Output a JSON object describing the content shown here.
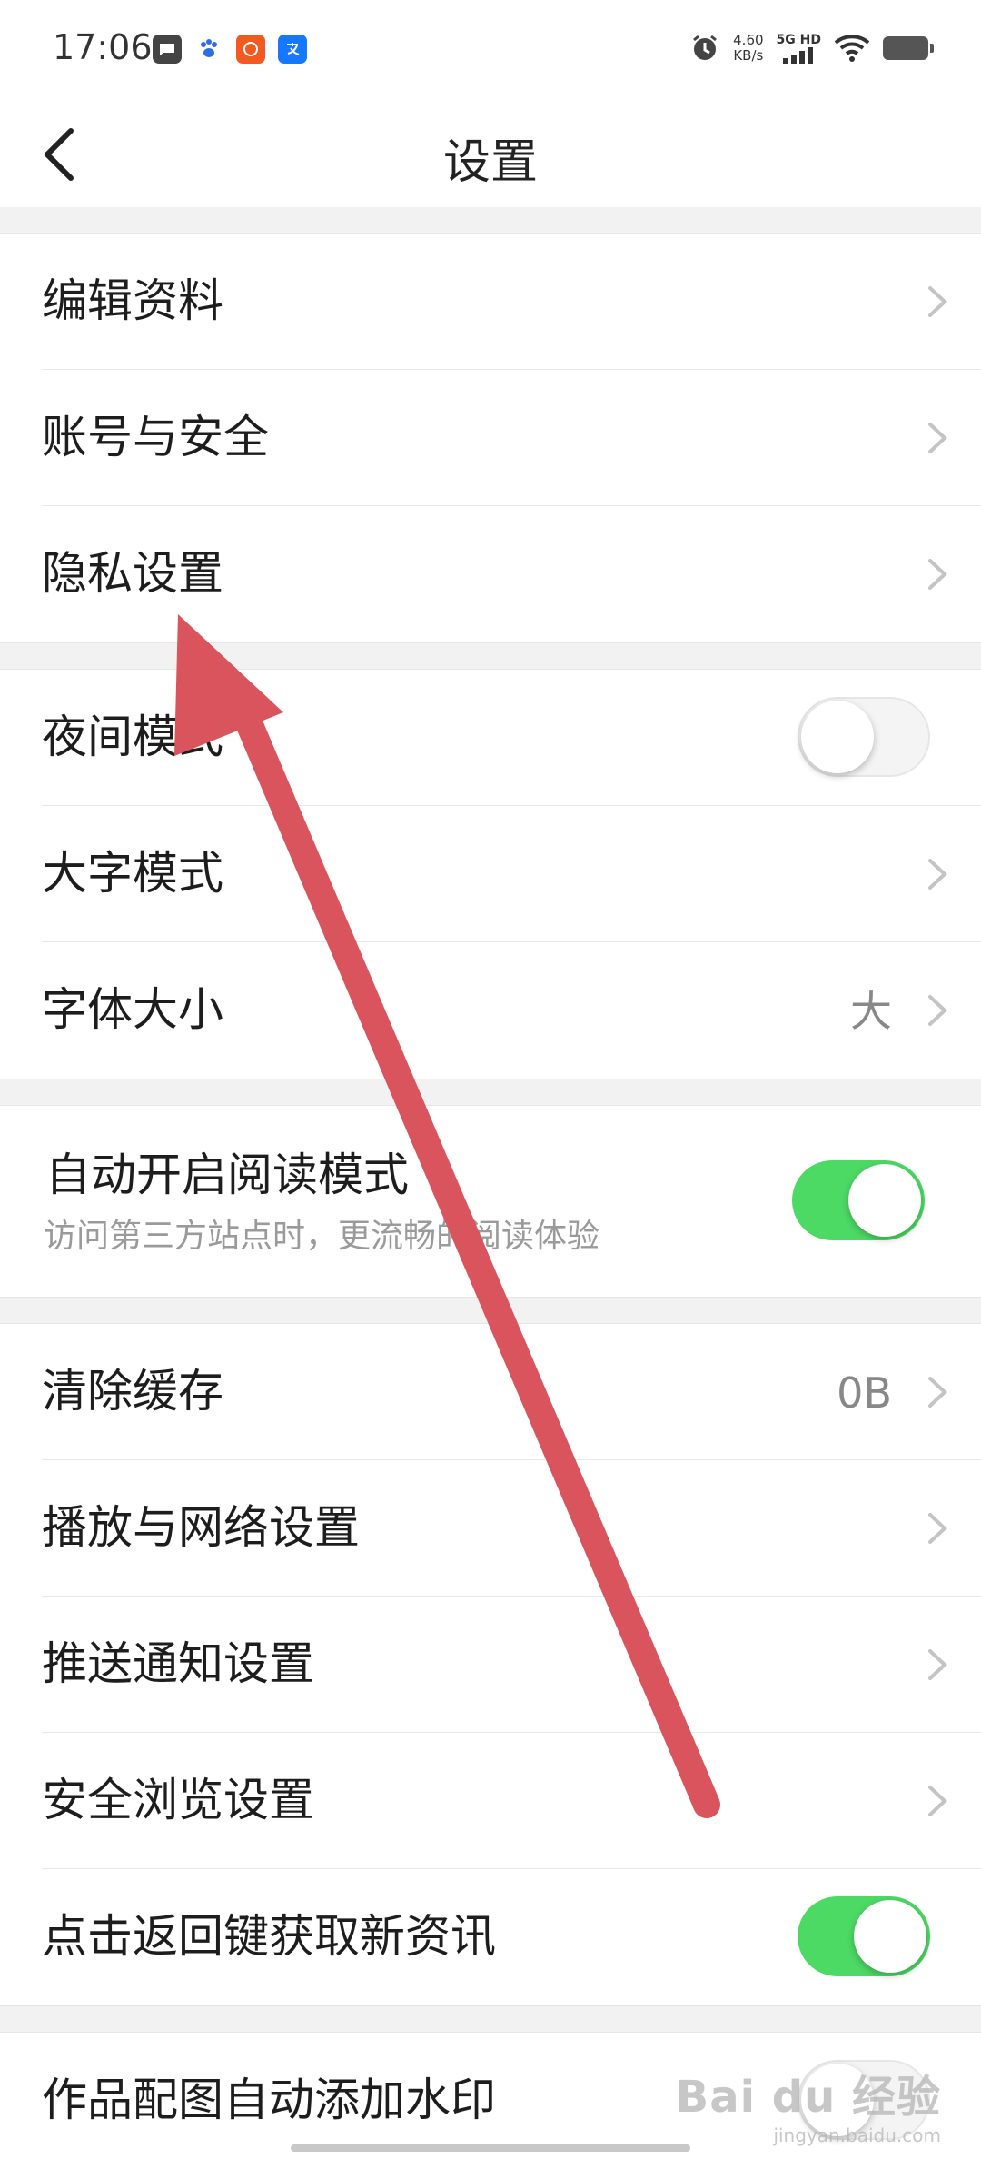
{
  "status_bar": {
    "time": "17:06",
    "net_speed_value": "4.60",
    "net_speed_unit": "KB/s",
    "net_type": "5G HD",
    "icons": [
      "message-app-icon",
      "baidu-paw-icon",
      "taobao-icon",
      "alipay-icon",
      "alarm-icon",
      "signal-icon",
      "wifi-icon",
      "battery-icon"
    ]
  },
  "header": {
    "title": "设置"
  },
  "groups": [
    {
      "items": [
        {
          "label": "编辑资料",
          "type": "link"
        },
        {
          "label": "账号与安全",
          "type": "link"
        },
        {
          "label": "隐私设置",
          "type": "link"
        }
      ]
    },
    {
      "items": [
        {
          "label": "夜间模式",
          "type": "toggle",
          "on": false
        },
        {
          "label": "大字模式",
          "type": "link"
        },
        {
          "label": "字体大小",
          "type": "link",
          "value": "大"
        }
      ]
    },
    {
      "items": [
        {
          "label": "自动开启阅读模式",
          "sub": "访问第三方站点时，更流畅的阅读体验",
          "type": "toggle",
          "on": true
        }
      ]
    },
    {
      "items": [
        {
          "label": "清除缓存",
          "type": "link",
          "value": "0B"
        },
        {
          "label": "播放与网络设置",
          "type": "link"
        },
        {
          "label": "推送通知设置",
          "type": "link"
        },
        {
          "label": "安全浏览设置",
          "type": "link"
        },
        {
          "label": "点击返回键获取新资讯",
          "type": "toggle",
          "on": true
        }
      ]
    },
    {
      "items": [
        {
          "label": "作品配图自动添加水印",
          "type": "toggle",
          "on": false
        }
      ]
    }
  ],
  "annotation": {
    "arrow_color": "#d9545c"
  },
  "watermark": {
    "logo": "Bai du 经验",
    "url": "jingyan.baidu.com"
  },
  "colors": {
    "toggle_on": "#4cd964",
    "section_gap": "#f2f2f2"
  }
}
